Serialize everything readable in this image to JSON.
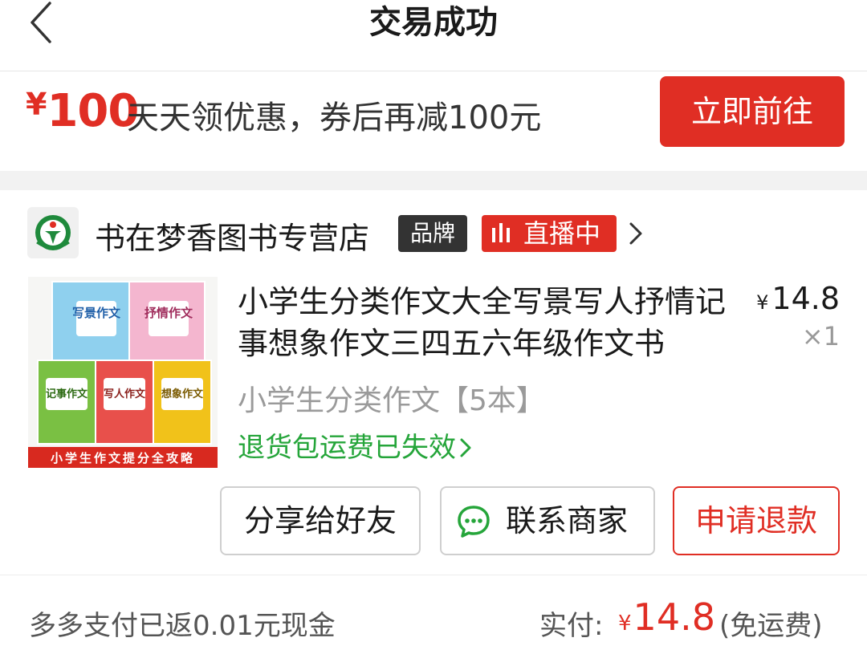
{
  "header": {
    "title": "交易成功"
  },
  "promo": {
    "currency": "¥",
    "amount": "100",
    "text": "天天领优惠，券后再减100元",
    "button_label": "立即前往"
  },
  "store": {
    "name": "书在梦香图书专营店",
    "brand_badge": "品牌",
    "live_badge": "直播中"
  },
  "product": {
    "title": "小学生分类作文大全写景写人抒情记事想象作文三四五六年级作文书",
    "currency": "¥",
    "price": "14.8",
    "quantity": "×1",
    "spec": "小学生分类作文【5本】",
    "refund_notice": "退货包运费已失效",
    "image": {
      "books": [
        "写景作文",
        "抒情作文",
        "记事作文",
        "写人作文",
        "想象作文"
      ],
      "banner": "小学生作文提分全攻略"
    }
  },
  "actions": {
    "share": "分享给好友",
    "contact": "联系商家",
    "refund": "申请退款"
  },
  "summary": {
    "cashback": "多多支付已返0.01元现金",
    "paid_label": "实付:",
    "currency": "¥",
    "paid_amount": "14.8",
    "shipping_note": "(免运费)"
  },
  "colors": {
    "accent": "#e02e24",
    "success": "#25a53a",
    "brand_badge": "#333333"
  }
}
